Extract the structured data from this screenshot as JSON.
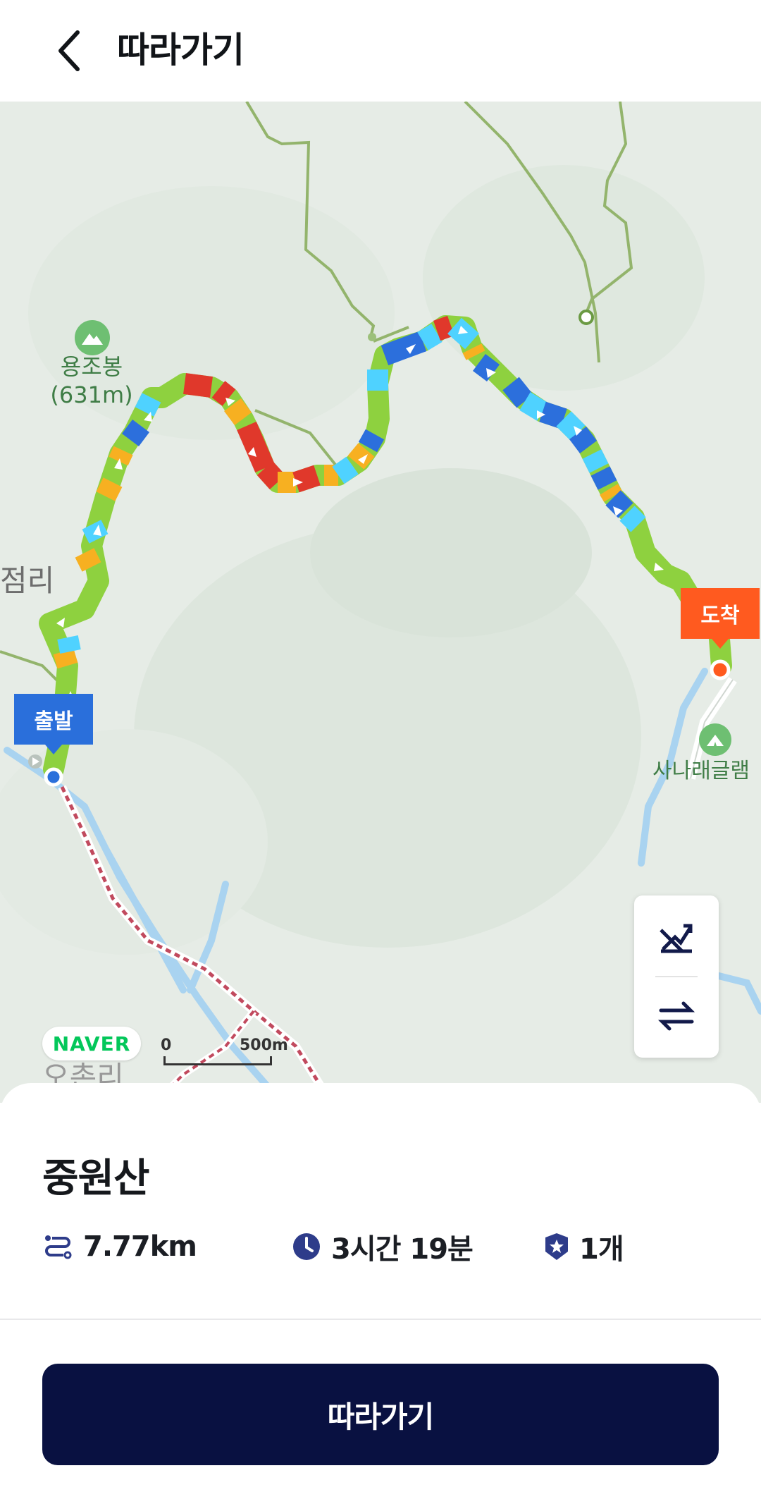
{
  "header": {
    "title": "따라가기"
  },
  "map": {
    "peak": {
      "name": "용조봉",
      "elevation": "(631m)"
    },
    "place_left": "점리",
    "place_bottom": "오촌리",
    "camp": "사나래글램",
    "start_label": "출발",
    "end_label": "도착",
    "naver_logo": "NAVER",
    "scale": {
      "zero": "0",
      "distance": "500m"
    }
  },
  "course": {
    "name": "중원산",
    "distance": "7.77km",
    "duration": "3시간 19분",
    "badge_count": "1개"
  },
  "actions": {
    "follow_label": "따라가기"
  },
  "colors": {
    "primary": "#091141",
    "start_marker": "#2a6fdb",
    "end_marker": "#ff5a1f",
    "trail_green": "#8ed13f",
    "trail_blue": "#2c6fdc",
    "trail_red": "#e0382b"
  }
}
